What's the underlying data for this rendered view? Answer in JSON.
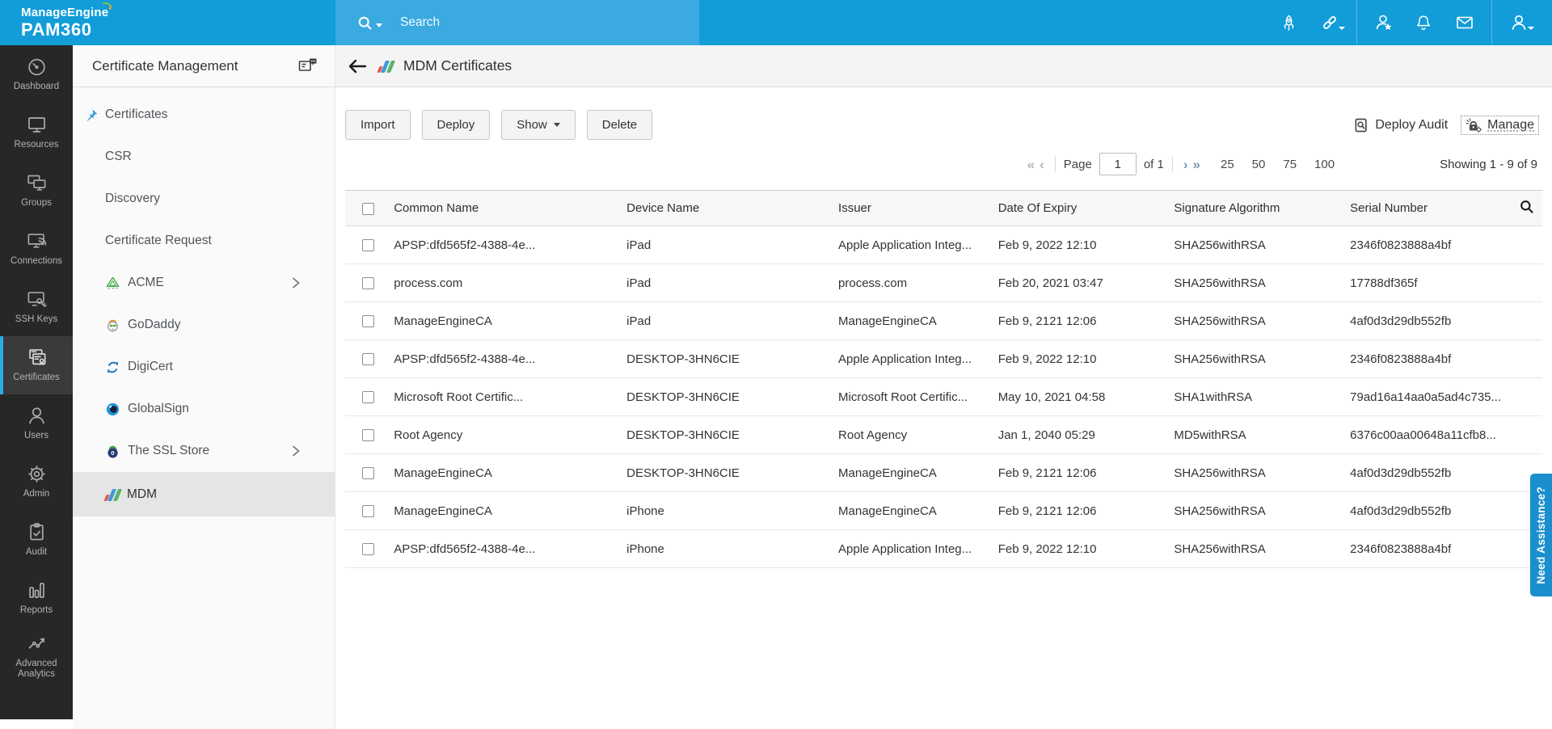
{
  "brand": {
    "company": "ManageEngine",
    "product": "PAM360"
  },
  "topbar": {
    "search_placeholder": "Search"
  },
  "left_rail": {
    "items": [
      {
        "label": "Dashboard",
        "active": false
      },
      {
        "label": "Resources",
        "active": false
      },
      {
        "label": "Groups",
        "active": false
      },
      {
        "label": "Connections",
        "active": false
      },
      {
        "label": "SSH Keys",
        "active": false
      },
      {
        "label": "Certificates",
        "active": true
      },
      {
        "label": "Users",
        "active": false
      },
      {
        "label": "Admin",
        "active": false
      },
      {
        "label": "Audit",
        "active": false
      },
      {
        "label": "Reports",
        "active": false
      },
      {
        "label": "Advanced Analytics",
        "active": false
      }
    ]
  },
  "sidebar": {
    "title": "Certificate Management",
    "items": [
      {
        "label": "Certificates"
      },
      {
        "label": "CSR"
      },
      {
        "label": "Discovery"
      },
      {
        "label": "Certificate Request"
      },
      {
        "label": "ACME"
      },
      {
        "label": "GoDaddy"
      },
      {
        "label": "DigiCert"
      },
      {
        "label": "GlobalSign"
      },
      {
        "label": "The SSL Store"
      },
      {
        "label": "MDM"
      }
    ]
  },
  "content": {
    "title": "MDM Certificates",
    "toolbar": {
      "import_label": "Import",
      "deploy_label": "Deploy",
      "show_label": "Show",
      "delete_label": "Delete",
      "deploy_audit_label": "Deploy Audit",
      "manage_label": "Manage"
    },
    "pagination": {
      "first_icon": "«",
      "prev_icon": "‹",
      "next_icon": "›",
      "last_icon": "»",
      "page_label": "Page",
      "page_value": "1",
      "of_label": "of 1",
      "sizes": [
        "25",
        "50",
        "75",
        "100"
      ],
      "showing": "Showing 1 - 9 of 9"
    },
    "table": {
      "columns": [
        "Common Name",
        "Device Name",
        "Issuer",
        "Date Of Expiry",
        "Signature Algorithm",
        "Serial Number"
      ],
      "rows": [
        {
          "common_name": "APSP:dfd565f2-4388-4e...",
          "device_name": "iPad",
          "issuer": "Apple Application Integ...",
          "expiry": "Feb 9, 2022 12:10",
          "algorithm": "SHA256withRSA",
          "serial": "2346f0823888a4bf"
        },
        {
          "common_name": "process.com",
          "device_name": "iPad",
          "issuer": "process.com",
          "expiry": "Feb 20, 2021 03:47",
          "algorithm": "SHA256withRSA",
          "serial": "17788df365f"
        },
        {
          "common_name": "ManageEngineCA",
          "device_name": "iPad",
          "issuer": "ManageEngineCA",
          "expiry": "Feb 9, 2121 12:06",
          "algorithm": "SHA256withRSA",
          "serial": "4af0d3d29db552fb"
        },
        {
          "common_name": "APSP:dfd565f2-4388-4e...",
          "device_name": "DESKTOP-3HN6CIE",
          "issuer": "Apple Application Integ...",
          "expiry": "Feb 9, 2022 12:10",
          "algorithm": "SHA256withRSA",
          "serial": "2346f0823888a4bf"
        },
        {
          "common_name": "Microsoft Root Certific...",
          "device_name": "DESKTOP-3HN6CIE",
          "issuer": "Microsoft Root Certific...",
          "expiry": "May 10, 2021 04:58",
          "algorithm": "SHA1withRSA",
          "serial": "79ad16a14aa0a5ad4c735..."
        },
        {
          "common_name": "Root Agency",
          "device_name": "DESKTOP-3HN6CIE",
          "issuer": "Root Agency",
          "expiry": "Jan 1, 2040 05:29",
          "algorithm": "MD5withRSA",
          "serial": "6376c00aa00648a11cfb8..."
        },
        {
          "common_name": "ManageEngineCA",
          "device_name": "DESKTOP-3HN6CIE",
          "issuer": "ManageEngineCA",
          "expiry": "Feb 9, 2121 12:06",
          "algorithm": "SHA256withRSA",
          "serial": "4af0d3d29db552fb"
        },
        {
          "common_name": "ManageEngineCA",
          "device_name": "iPhone",
          "issuer": "ManageEngineCA",
          "expiry": "Feb 9, 2121 12:06",
          "algorithm": "SHA256withRSA",
          "serial": "4af0d3d29db552fb"
        },
        {
          "common_name": "APSP:dfd565f2-4388-4e...",
          "device_name": "iPhone",
          "issuer": "Apple Application Integ...",
          "expiry": "Feb 9, 2022 12:10",
          "algorithm": "SHA256withRSA",
          "serial": "2346f0823888a4bf"
        }
      ]
    }
  },
  "assist_tab": {
    "label": "Need Assistance?"
  },
  "colors": {
    "header_blue": "#129dd9",
    "search_band_blue": "#3aaae0",
    "rail_dark": "#272727",
    "rail_active": "#3a3a3a",
    "accent_blue": "#2bace4",
    "sidebar_bg": "#fafafa",
    "sidebar_active": "#e5e5e5",
    "strip_bg": "#f4f4f4",
    "assist_blue": "#1b8fce"
  }
}
